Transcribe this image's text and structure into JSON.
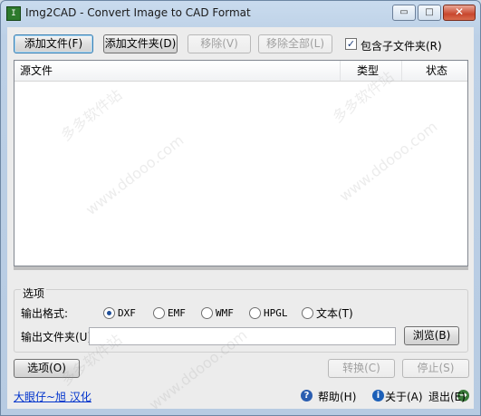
{
  "window": {
    "title": "Img2CAD - Convert Image to CAD Format",
    "icon": "app-icon",
    "controls": {
      "minimize": "▭",
      "maximize": "□",
      "close": "✕"
    }
  },
  "toolbar": {
    "add_file": "添加文件(F)",
    "add_folder": "添加文件夹(D)",
    "remove": "移除(V)",
    "remove_all": "移除全部(L)",
    "include_subfolders": {
      "label": "包含子文件夹(R)",
      "checked": true,
      "mark": "✓"
    }
  },
  "file_list": {
    "columns": [
      "源文件",
      "类型",
      "状态"
    ],
    "rows": []
  },
  "options": {
    "group_title": "选项",
    "format_label": "输出格式:",
    "formats": [
      "DXF",
      "EMF",
      "WMF",
      "HPGL",
      "文本(T)"
    ],
    "selected_format": "DXF",
    "output_folder_label": "输出文件夹(U)",
    "output_folder_value": "",
    "browse": "浏览(B)"
  },
  "actions": {
    "options": "选项(O)",
    "convert": "转换(C)",
    "stop": "停止(S)"
  },
  "footer": {
    "credit": "大眼仔~旭 汉化",
    "help": "帮助(H)",
    "about": "关于(A)",
    "exit": "退出(E)",
    "help_icon": "?",
    "about_icon": "i",
    "exit_icon": "→"
  },
  "watermark": [
    "多多软件站",
    "www.ddooo.com"
  ],
  "colors": {
    "accent": "#3c7fb1",
    "link": "#0033cc",
    "close": "#c8472d"
  }
}
